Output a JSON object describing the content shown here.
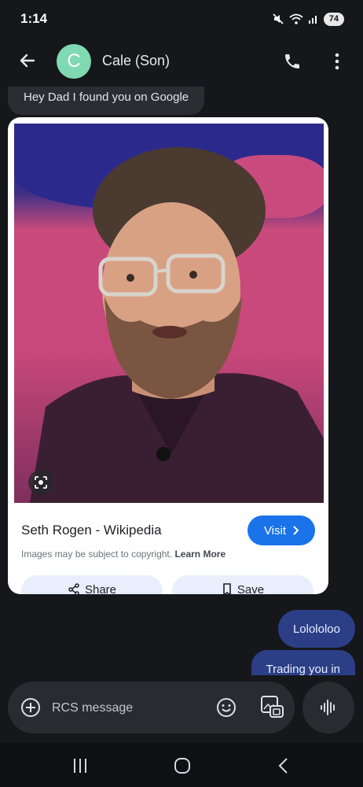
{
  "status_bar": {
    "time": "1:14",
    "battery": "74",
    "icons": [
      "mute-icon",
      "wifi-icon",
      "signal-icon"
    ]
  },
  "header": {
    "avatar_letter": "C",
    "avatar_color": "#7fd9b1",
    "contact_name": "Cale (Son)"
  },
  "messages": {
    "incoming_1": "Hey Dad I found you on Google",
    "card": {
      "title": "Seth Rogen - Wikipedia",
      "visit_label": "Visit",
      "copyright_text": "Images may be subject to copyright.",
      "learn_more": "Learn More",
      "share_label": "Share",
      "save_label": "Save"
    },
    "outgoing_1": "Lolololoo",
    "outgoing_2": "Trading you in"
  },
  "composer": {
    "placeholder": "RCS message"
  },
  "colors": {
    "accent": "#1a73e8",
    "outgoing_bubble": "#2c3f86",
    "background": "#16171b"
  }
}
